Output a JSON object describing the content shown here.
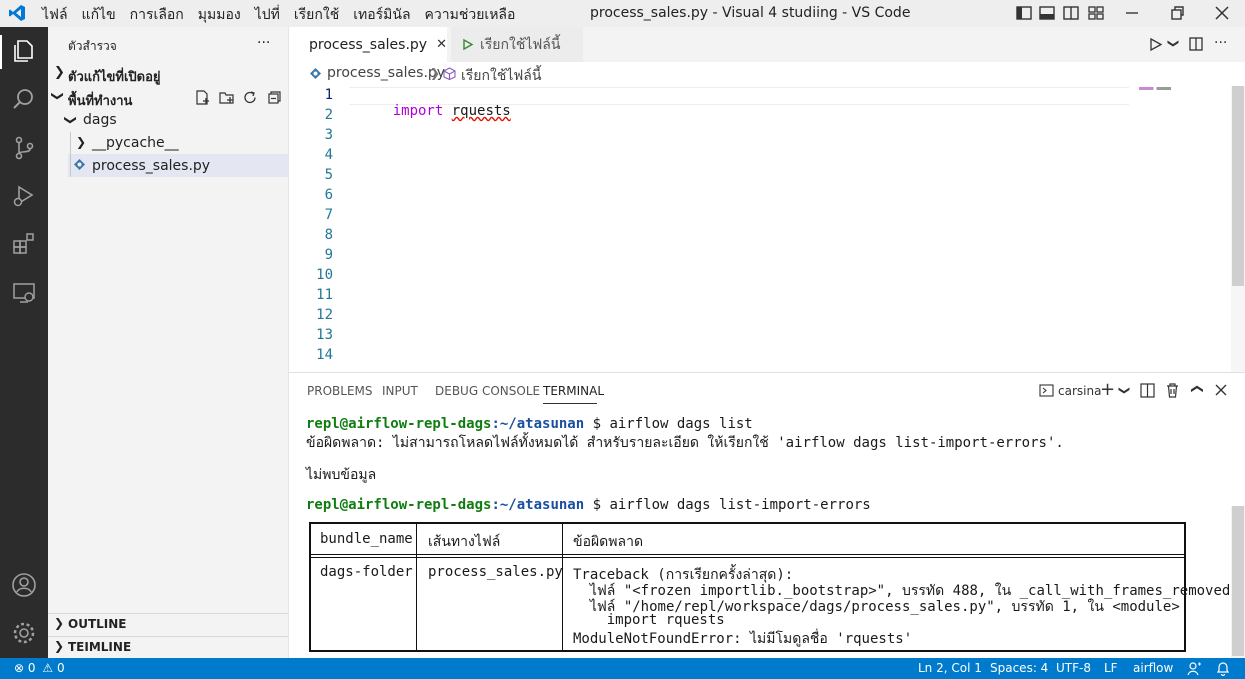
{
  "titlebar": {
    "menu": [
      "ไฟล์",
      "แก้ไข",
      "การเลือก",
      "มุมมอง",
      "ไปที่",
      "เรียกใช้",
      "เทอร์มินัล",
      "ความช่วยเหลือ"
    ],
    "title": "process_sales.py - Visual 4 studiing - VS Code"
  },
  "sidebar": {
    "header": "ตัวสำรวจ",
    "more": "···",
    "open_editors": "ตัวแก้ไขที่เปิดอยู่",
    "workspace": "พื้นที่ทำงาน",
    "tree": [
      "dags",
      "__pycache__",
      "process_sales.py"
    ],
    "outline": "OUTLINE",
    "timeline": "TEIMLINE"
  },
  "tabs": {
    "active": "process_sales.py",
    "run": "เรียกใช้ไฟล์นี้"
  },
  "breadcrumb": {
    "file": "process_sales.py",
    "symbol": "เรียกใช้ไฟล์นี้"
  },
  "editor": {
    "keyword": "import",
    "module": "rquests",
    "line_numbers": [
      "1",
      "2",
      "3",
      "4",
      "5",
      "6",
      "7",
      "8",
      "9",
      "10",
      "11",
      "12",
      "13",
      "14"
    ]
  },
  "panel": {
    "tabs": [
      "PROBLEMS",
      "INPUT",
      "DEBUG CONSOLE",
      "TERMINAL"
    ],
    "shell_name": "carsina",
    "prompt_user": "repl@airflow-repl-dags",
    "prompt_path": ":~/atasunan",
    "cmd1": " $ airflow dags list",
    "out1": "ข้อผิดพลาด: ไม่สามารถโหลดไฟล์ทั้งหมดได้ สำหรับรายละเอียด ให้เรียกใช้ 'airflow dags list-import-errors'.",
    "out2": "ไม่พบข้อมูล",
    "cmd2": " $ airflow dags list-import-errors",
    "table": {
      "headers": [
        "bundle_name",
        "เส้นทางไฟล์",
        "ข้อผิดพลาด"
      ],
      "bundle": "dags-folder",
      "filepath": "process_sales.py",
      "error_lines": [
        "Traceback (การเรียกครั้งล่าสุด):",
        "  ไฟล์ \"<frozen importlib._bootstrap>\", บรรทัด 488, ใน _call_with_frames_removed",
        "  ไฟล์ \"/home/repl/workspace/dags/process_sales.py\", บรรทัด 1, ใน <module>",
        "    import rquests",
        "ModuleNotFoundError: ไม่มีโมดูลชื่อ 'rquests'"
      ]
    }
  },
  "statusbar": {
    "errors": "0",
    "warnings": "0",
    "position": "Ln 2, Col 1",
    "spaces": "Spaces: 4",
    "encoding": "UTF-8",
    "eol": "LF",
    "language": "airflow"
  },
  "colors": {
    "accent": "#007acc",
    "activity_bar": "#2c2c2c",
    "keyword": "#af00db"
  }
}
